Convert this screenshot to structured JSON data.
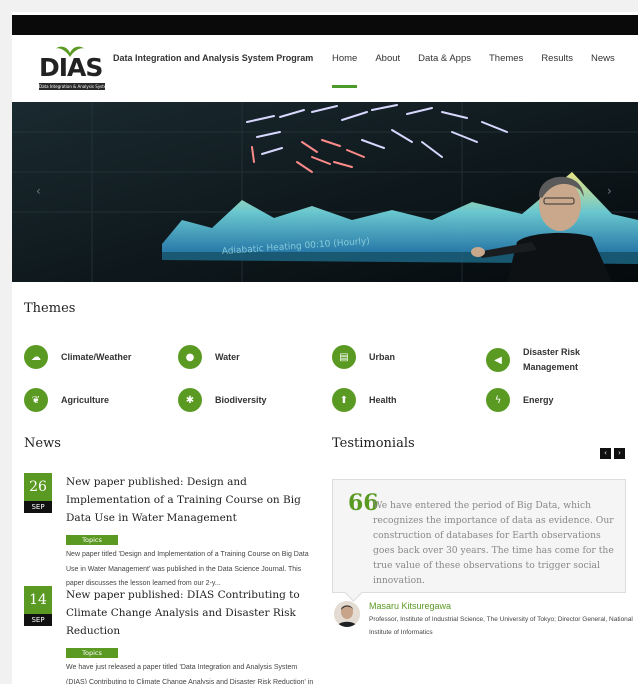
{
  "header": {
    "logo_word": "DIAS",
    "logo_sub": "Data Integration & Analysis System",
    "site_title": "Data Integration and Analysis System Program",
    "nav": [
      {
        "label": "Home",
        "active": true
      },
      {
        "label": "About"
      },
      {
        "label": "Data & Apps"
      },
      {
        "label": "Themes"
      },
      {
        "label": "Results"
      },
      {
        "label": "News"
      }
    ]
  },
  "hero": {
    "prev_label": "‹",
    "next_label": "›"
  },
  "themes": {
    "heading": "Themes",
    "items": [
      {
        "label": "Climate/Weather",
        "icon": "cloud-icon"
      },
      {
        "label": "Water",
        "icon": "droplet-icon"
      },
      {
        "label": "Urban",
        "icon": "building-icon"
      },
      {
        "label": "Disaster Risk Management",
        "icon": "megaphone-icon"
      },
      {
        "label": "Agriculture",
        "icon": "leaf-icon"
      },
      {
        "label": "Biodiversity",
        "icon": "bug-icon"
      },
      {
        "label": "Health",
        "icon": "thermometer-icon"
      },
      {
        "label": "Energy",
        "icon": "bolt-icon"
      }
    ]
  },
  "news": {
    "heading": "News",
    "items": [
      {
        "day": "26",
        "month": "SEP",
        "title": "New paper published: Design and Implementation of a Training Course on Big Data Use in Water Management",
        "tag": "Topics",
        "excerpt": "New paper titled 'Design and Implementation of a Training Course on Big Data Use in Water Management' was published in the Data Science Journal. This paper discusses the lesson learned from our 2-y..."
      },
      {
        "day": "14",
        "month": "SEP",
        "title": "New paper published: DIAS Contributing to Climate Change Analysis and Disaster Risk Reduction",
        "tag": "Topics",
        "excerpt": "We have just released a paper titled 'Data Integration and Analysis System (DIAS) Contributing to Climate Change Analysis and Disaster Risk Reduction' in Data Science Journal. The paper gives an ov..."
      }
    ]
  },
  "testimonials": {
    "heading": "Testimonials",
    "prev_label": "‹",
    "next_label": "›",
    "quote_mark": "66",
    "quote": "We have entered the period of Big Data, which recognizes the importance of data as evidence. Our construction of databases for Earth observations goes back over 30 years. The time has come for the true value of these observations to trigger social innovation.",
    "name": "Masaru Kitsuregawa",
    "role": "Professor, Institute of Industrial Science, The University of Tokyo; Director General, National Institute of Informatics"
  },
  "colors": {
    "accent": "#5a9a22",
    "dark": "#111111"
  }
}
